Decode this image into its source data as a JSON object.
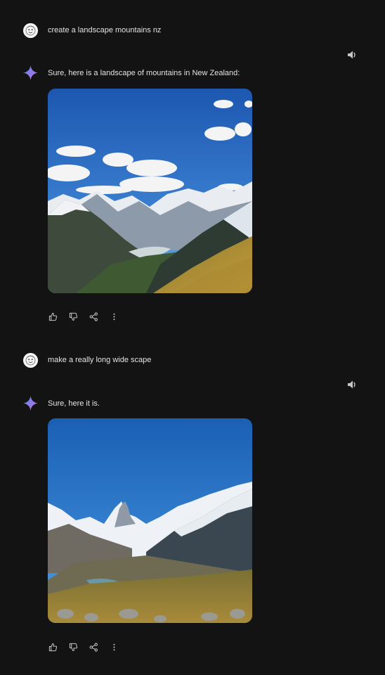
{
  "conversation": [
    {
      "user": {
        "prompt": "create a landscape mountains nz",
        "avatar_icon": "user-avatar"
      },
      "model": {
        "reply": "Sure, here is a landscape of mountains in New Zealand:",
        "icons": {
          "assistant": "sparkle-icon",
          "speaker": "speaker-icon",
          "actions": [
            "thumbs-up-icon",
            "thumbs-down-icon",
            "share-icon",
            "more-vert-icon"
          ]
        }
      }
    },
    {
      "user": {
        "prompt": "make a really long wide scape",
        "avatar_icon": "user-avatar"
      },
      "model": {
        "reply": "Sure, here it is.",
        "icons": {
          "assistant": "sparkle-icon",
          "speaker": "speaker-icon",
          "actions": [
            "thumbs-up-icon",
            "thumbs-down-icon",
            "share-icon",
            "more-vert-icon"
          ]
        }
      }
    }
  ],
  "colors": {
    "background": "#131314",
    "text": "#e3e3e3",
    "icon": "#c4c7c5",
    "sparkle_start": "#4f8cf5",
    "sparkle_end": "#c86ad9"
  }
}
